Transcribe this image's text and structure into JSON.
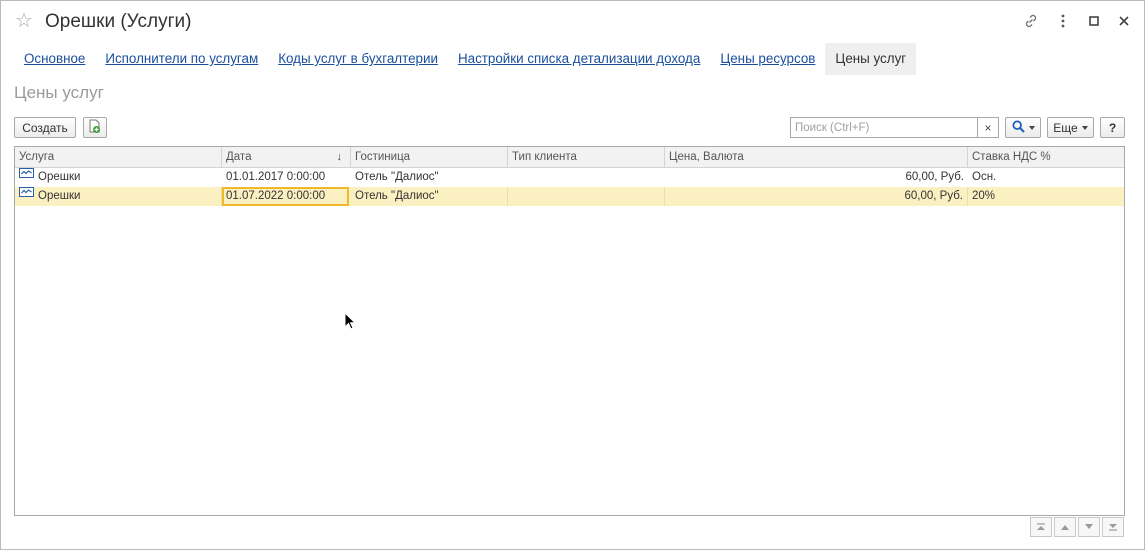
{
  "window": {
    "title": "Орешки (Услуги)",
    "star_icon": "star-icon",
    "controls": [
      "link-icon",
      "more-icon",
      "maximize-icon",
      "close-icon"
    ]
  },
  "tabs": [
    {
      "label": "Основное",
      "active": false
    },
    {
      "label": "Исполнители по услугам",
      "active": false
    },
    {
      "label": "Коды услуг в бухгалтерии",
      "active": false
    },
    {
      "label": "Настройки списка детализации дохода",
      "active": false
    },
    {
      "label": "Цены ресурсов",
      "active": false
    },
    {
      "label": "Цены услуг",
      "active": true
    }
  ],
  "section_title": "Цены услуг",
  "toolbar": {
    "create_label": "Создать",
    "copy_icon": "add-document-icon",
    "search_placeholder": "Поиск (Ctrl+F)",
    "search_value": "",
    "clear_label": "×",
    "search_icon": "magnifier-icon",
    "more_label": "Еще",
    "help_label": "?"
  },
  "table": {
    "columns": [
      "Услуга",
      "Дата",
      "Гостиница",
      "Тип клиента",
      "Цена, Валюта",
      "Ставка НДС %"
    ],
    "sort_indicator": "↓",
    "rows": [
      {
        "service": "Орешки",
        "date": "01.01.2017 0:00:00",
        "hotel": "Отель \"Далиос\"",
        "client_type": "",
        "price": "60,00, Руб.",
        "vat": "Осн.",
        "selected": false
      },
      {
        "service": "Орешки",
        "date": "01.07.2022 0:00:00",
        "hotel": "Отель \"Далиос\"",
        "client_type": "",
        "price": "60,00, Руб.",
        "vat": "20%",
        "selected": true
      }
    ]
  },
  "colors": {
    "link": "#1a4f9c",
    "selected_row": "#fbf0c2",
    "focus_border": "#f1b82c",
    "active_tab_bg": "#efefef"
  },
  "scroll_nav": [
    "scroll-top-icon",
    "scroll-up-icon",
    "scroll-down-icon",
    "scroll-bottom-icon"
  ]
}
